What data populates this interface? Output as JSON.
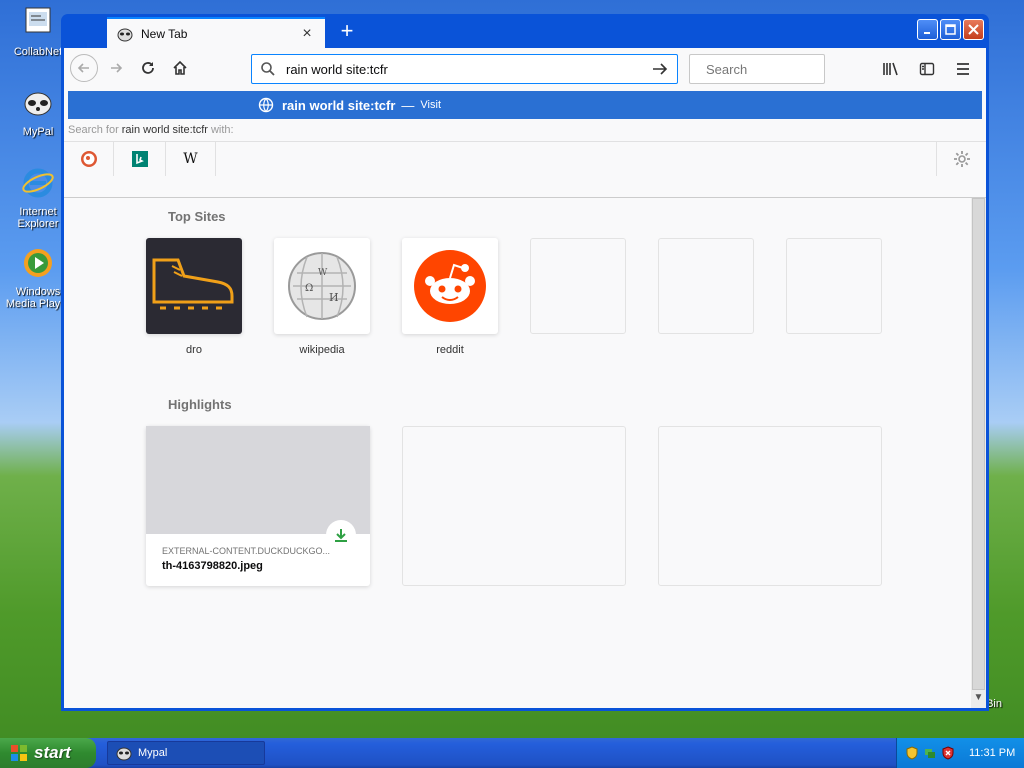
{
  "desktop": {
    "icons": [
      {
        "label": "CollabNet"
      },
      {
        "label": "MyPal"
      },
      {
        "label": "Internet Explorer"
      },
      {
        "label": "Windows Media Player"
      }
    ],
    "recycle_bin_label": "Bin"
  },
  "browser": {
    "tab": {
      "title": "New Tab",
      "close": "×"
    },
    "new_tab": "+",
    "url_value": "rain world site:tcfr",
    "search_placeholder": "Search",
    "suggestion": {
      "query": "rain world site:tcfr",
      "separator": "—",
      "action": "Visit"
    },
    "search_with": {
      "prefix": "Search for",
      "query": "rain world site:tcfr",
      "suffix": "with:"
    },
    "engines": [
      "duckduckgo-icon",
      "bing-icon",
      "wikipedia-icon"
    ],
    "engine_wiki_letter": "W"
  },
  "newtab": {
    "top_sites_title": "Top Sites",
    "top_sites": [
      {
        "label": "dro",
        "icon": "boot-icon"
      },
      {
        "label": "wikipedia",
        "icon": "wikipedia-globe-icon"
      },
      {
        "label": "reddit",
        "icon": "reddit-icon"
      },
      {
        "label": ""
      },
      {
        "label": ""
      },
      {
        "label": ""
      }
    ],
    "highlights_title": "Highlights",
    "highlights": [
      {
        "host": "EXTERNAL-CONTENT.DUCKDUCKGO...",
        "filename": "th-4163798820.jpeg"
      }
    ]
  },
  "taskbar": {
    "start_label": "start",
    "task_label": "Mypal",
    "clock": "11:31 PM"
  },
  "colors": {
    "accent": "#0a84ff",
    "suggest_bg": "#2a70d3",
    "reddit": "#ff4500",
    "boot_tile": "#2b2a33",
    "download_green": "#2ea043"
  }
}
